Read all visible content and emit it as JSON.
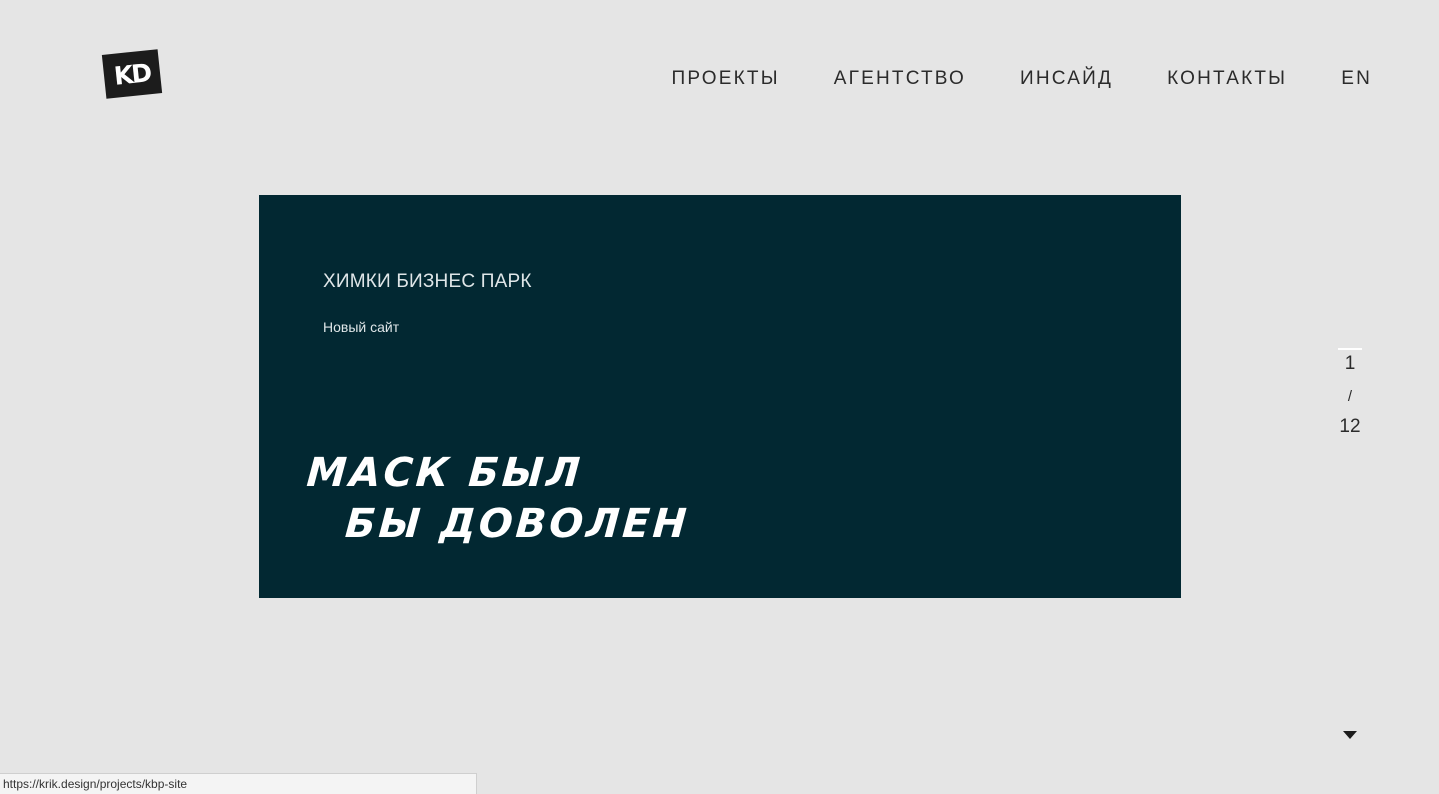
{
  "header": {
    "logo_text": "KD",
    "nav": [
      {
        "label": "ПРОЕКТЫ"
      },
      {
        "label": "АГЕНТСТВО"
      },
      {
        "label": "ИНСАЙД"
      },
      {
        "label": "КОНТАКТЫ"
      },
      {
        "label": "EN"
      }
    ]
  },
  "hero": {
    "title": "ХИМКИ БИЗНЕС ПАРК",
    "subtitle": "Новый сайт",
    "headline_line1": "МАСК БЫЛ",
    "headline_line2": "БЫ ДОВОЛЕН",
    "background_color": "#022832"
  },
  "pager": {
    "current": "1",
    "separator": "/",
    "total": "12"
  },
  "scroll_indicator": {
    "icon": "triangle-down-icon"
  },
  "status_bar": {
    "url": "https://krik.design/projects/kbp-site"
  }
}
